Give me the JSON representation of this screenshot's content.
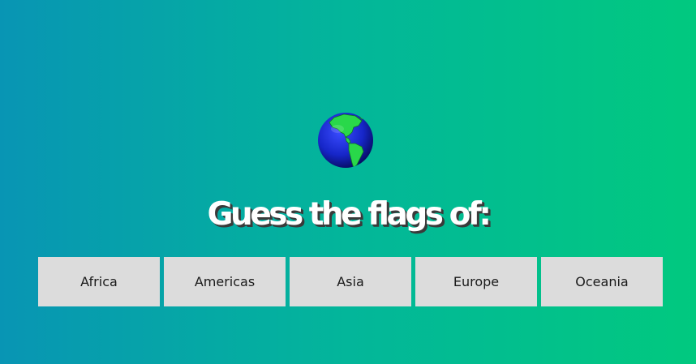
{
  "title": "Guess the flags of:",
  "globe_icon": "earth-americas-icon",
  "regions": [
    {
      "label": "Africa"
    },
    {
      "label": "Americas"
    },
    {
      "label": "Asia"
    },
    {
      "label": "Europe"
    },
    {
      "label": "Oceania"
    }
  ],
  "colors": {
    "background_start": "#0895b4",
    "background_end": "#01c97f",
    "button_bg": "#dcdcdc",
    "title": "#ffffff"
  }
}
